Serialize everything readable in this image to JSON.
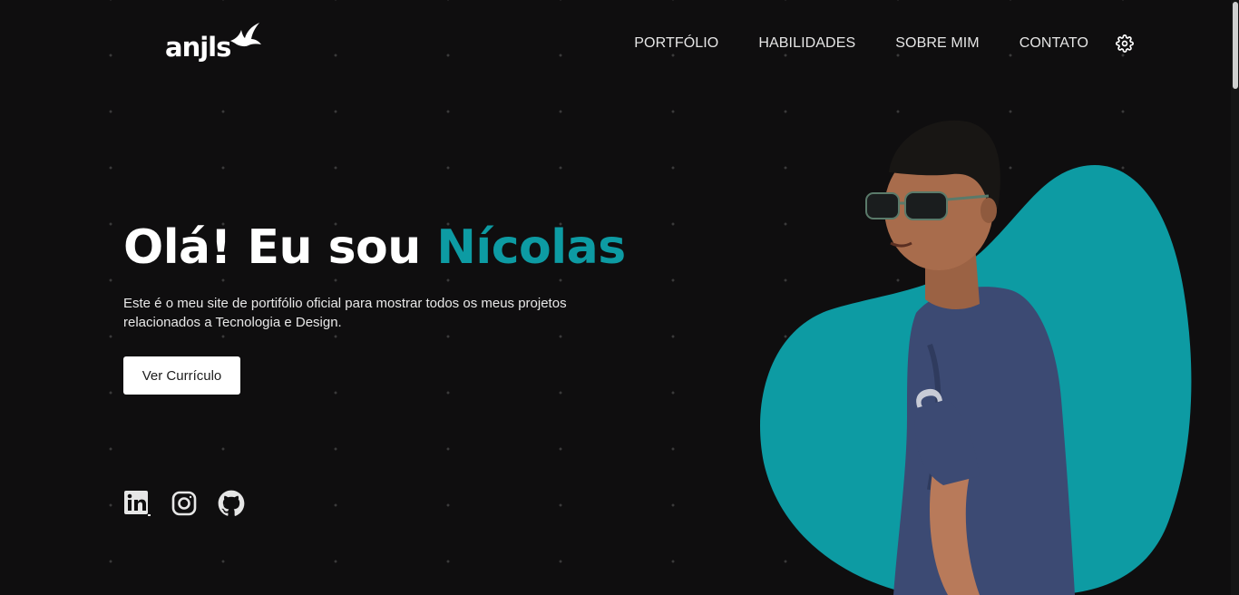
{
  "brand": {
    "logo_text": "anjls",
    "logo_icon": "bird-icon"
  },
  "nav": {
    "items": [
      {
        "label": "PORTFÓLIO"
      },
      {
        "label": "HABILIDADES"
      },
      {
        "label": "SOBRE MIM"
      },
      {
        "label": "CONTATO"
      }
    ],
    "settings_icon": "gear-icon"
  },
  "hero": {
    "greeting": "Olá! Eu sou ",
    "name": "Nícolas",
    "description": "Este é o meu site de portifólio oficial para mostrar todos os meus projetos relacionados a Tecnologia e Design.",
    "button_label": "Ver Currículo"
  },
  "socials": [
    {
      "icon": "linkedin-icon"
    },
    {
      "icon": "instagram-icon"
    },
    {
      "icon": "github-icon"
    }
  ],
  "colors": {
    "background": "#0f0e0f",
    "accent": "#0d9ba3",
    "text": "#ffffff",
    "button_bg": "#ffffff"
  }
}
